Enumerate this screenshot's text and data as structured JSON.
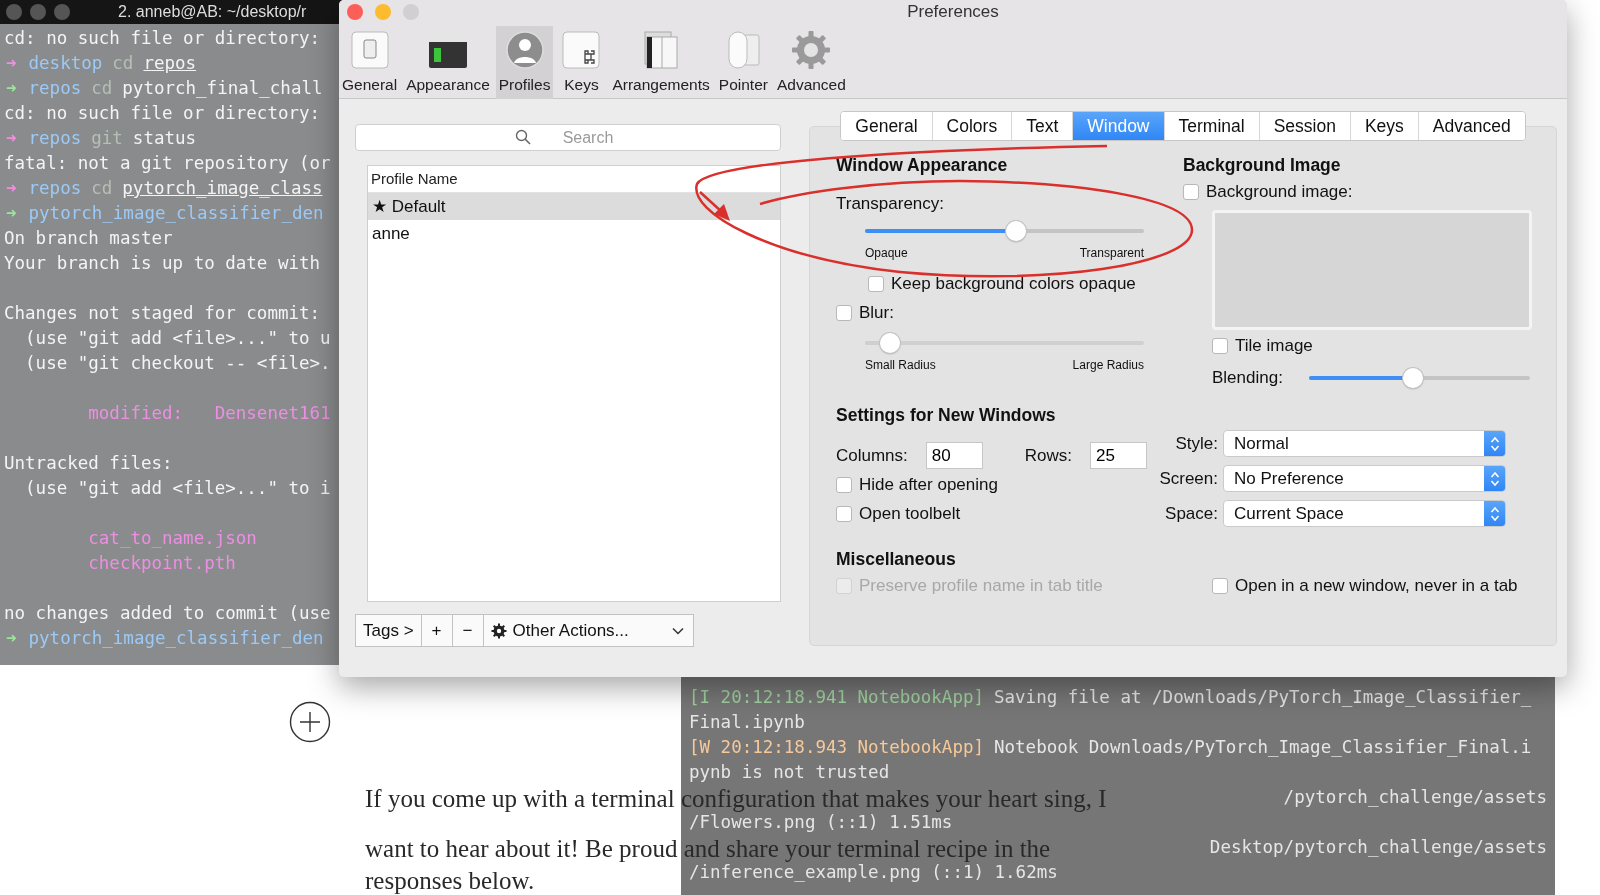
{
  "terminal": {
    "title": "2. anneb@AB: ~/desktop/r",
    "lines": [
      {
        "kind": "text",
        "segments": [
          {
            "kind": "plain",
            "text": "cd: no such file or directory:"
          }
        ]
      },
      {
        "kind": "text",
        "segments": [
          {
            "kind": "arrow",
            "text": "➜",
            "color": "#f08ee0"
          },
          {
            "kind": "dir",
            "text": "desktop"
          },
          {
            "kind": "cmd",
            "text": "cd"
          },
          {
            "kind": "path",
            "text": "repos"
          }
        ]
      },
      {
        "kind": "text",
        "segments": [
          {
            "kind": "arrow",
            "text": "➜",
            "color": "#9be59b"
          },
          {
            "kind": "dir",
            "text": "repos"
          },
          {
            "kind": "cmd",
            "text": "cd"
          },
          {
            "kind": "plain",
            "text": "pytorch_final_chall"
          }
        ]
      },
      {
        "kind": "text",
        "segments": [
          {
            "kind": "plain",
            "text": "cd: no such file or directory:"
          }
        ]
      },
      {
        "kind": "text",
        "segments": [
          {
            "kind": "arrow",
            "text": "➜",
            "color": "#f08ee0"
          },
          {
            "kind": "dir",
            "text": "repos"
          },
          {
            "kind": "cmd",
            "text": "git"
          },
          {
            "kind": "plain",
            "text": "status"
          }
        ]
      },
      {
        "kind": "text",
        "segments": [
          {
            "kind": "plain",
            "text": "fatal: not a git repository (or"
          }
        ]
      },
      {
        "kind": "text",
        "segments": [
          {
            "kind": "arrow",
            "text": "➜",
            "color": "#f08ee0"
          },
          {
            "kind": "dir",
            "text": "repos"
          },
          {
            "kind": "cmd",
            "text": "cd"
          },
          {
            "kind": "path",
            "text": "pytorch_image_class"
          }
        ]
      },
      {
        "kind": "text",
        "segments": [
          {
            "kind": "arrow",
            "text": "➜",
            "color": "#9be59b"
          },
          {
            "kind": "dir",
            "text": "pytorch_image_classifier_den"
          }
        ]
      },
      {
        "kind": "text",
        "segments": [
          {
            "kind": "plain",
            "text": "On branch master"
          }
        ]
      },
      {
        "kind": "text",
        "segments": [
          {
            "kind": "plain",
            "text": "Your branch is up to date with"
          }
        ]
      },
      {
        "kind": "blank"
      },
      {
        "kind": "text",
        "segments": [
          {
            "kind": "plain",
            "text": "Changes not staged for commit:"
          }
        ]
      },
      {
        "kind": "text",
        "segments": [
          {
            "kind": "plain",
            "text": "  (use \"git add <file>...\" to u"
          }
        ]
      },
      {
        "kind": "text",
        "segments": [
          {
            "kind": "plain",
            "text": "  (use \"git checkout -- <file>."
          }
        ]
      },
      {
        "kind": "blank"
      },
      {
        "kind": "text",
        "segments": [
          {
            "kind": "file",
            "text": "        modified:   Densenet161"
          }
        ]
      },
      {
        "kind": "blank"
      },
      {
        "kind": "text",
        "segments": [
          {
            "kind": "plain",
            "text": "Untracked files:"
          }
        ]
      },
      {
        "kind": "text",
        "segments": [
          {
            "kind": "plain",
            "text": "  (use \"git add <file>...\" to i"
          }
        ]
      },
      {
        "kind": "blank"
      },
      {
        "kind": "text",
        "segments": [
          {
            "kind": "file",
            "text": "        cat_to_name.json"
          }
        ]
      },
      {
        "kind": "text",
        "segments": [
          {
            "kind": "file",
            "text": "        checkpoint.pth"
          }
        ]
      },
      {
        "kind": "blank"
      },
      {
        "kind": "text",
        "segments": [
          {
            "kind": "plain",
            "text": "no changes added to commit (use"
          }
        ]
      },
      {
        "kind": "text",
        "segments": [
          {
            "kind": "arrow",
            "text": "➜",
            "color": "#9be59b"
          },
          {
            "kind": "dir",
            "text": "pytorch_image_classifier_den"
          }
        ]
      }
    ]
  },
  "preferences": {
    "title": "Preferences",
    "toolbar": [
      {
        "label": "General",
        "selected": false
      },
      {
        "label": "Appearance",
        "selected": false
      },
      {
        "label": "Profiles",
        "selected": true
      },
      {
        "label": "Keys",
        "selected": false
      },
      {
        "label": "Arrangements",
        "selected": false
      },
      {
        "label": "Pointer",
        "selected": false
      },
      {
        "label": "Advanced",
        "selected": false
      }
    ],
    "profiles": {
      "search_placeholder": "Search",
      "column": "Profile Name",
      "items": [
        {
          "name": "★ Default",
          "selected": true
        },
        {
          "name": "anne",
          "selected": false
        }
      ],
      "tags_button": "Tags >",
      "add_button": "+",
      "remove_button": "−",
      "actions_menu": "Other Actions..."
    },
    "tabs": [
      {
        "label": "General",
        "selected": false
      },
      {
        "label": "Colors",
        "selected": false
      },
      {
        "label": "Text",
        "selected": false
      },
      {
        "label": "Window",
        "selected": true
      },
      {
        "label": "Terminal",
        "selected": false
      },
      {
        "label": "Session",
        "selected": false
      },
      {
        "label": "Keys",
        "selected": false
      },
      {
        "label": "Advanced",
        "selected": false
      }
    ],
    "window_appearance": {
      "heading": "Window Appearance",
      "transparency": {
        "label": "Transparency:",
        "level": 0.54,
        "min_label": "Opaque",
        "max_label": "Transparent"
      },
      "keep_opaque": {
        "label": "Keep background colors opaque",
        "checked": false
      },
      "blur": {
        "label": "Blur:",
        "checked": false,
        "level": 0.09,
        "min_label": "Small Radius",
        "max_label": "Large Radius"
      }
    },
    "background_image": {
      "heading": "Background Image",
      "enabled": {
        "label": "Background image:",
        "checked": false
      },
      "tile": {
        "label": "Tile image",
        "checked": false
      },
      "blending": {
        "label": "Blending:",
        "level": 0.47
      }
    },
    "new_windows": {
      "heading": "Settings for New Windows",
      "columns": {
        "label": "Columns:",
        "value": "80"
      },
      "rows": {
        "label": "Rows:",
        "value": "25"
      },
      "hide_after_opening": {
        "label": "Hide after opening",
        "checked": false
      },
      "open_toolbelt": {
        "label": "Open toolbelt",
        "checked": false
      },
      "popups": [
        {
          "label": "Style:",
          "value": "Normal"
        },
        {
          "label": "Screen:",
          "value": "No Preference"
        },
        {
          "label": "Space:",
          "value": "Current Space"
        }
      ]
    },
    "misc": {
      "heading": "Miscellaneous",
      "preserve_name": {
        "label": "Preserve profile name in tab title",
        "checked": false,
        "disabled": true
      },
      "new_window": {
        "label": "Open in a new window, never in a tab",
        "checked": false,
        "disabled": false
      }
    }
  },
  "jupyter": {
    "lines": [
      {
        "kind": "info",
        "prefix": "[I 20:12:18.941 NotebookApp]",
        "text": "Saving file at /Downloads/PyTorch_Image_Classifier_"
      },
      {
        "kind": "cont",
        "text": "Final.ipynb"
      },
      {
        "kind": "warn",
        "prefix": "[W 20:12:18.943 NotebookApp]",
        "text": "Notebook Downloads/PyTorch_Image_Classifier_Final.i"
      },
      {
        "kind": "cont",
        "text": "pynb is not trusted"
      },
      {
        "kind": "tail",
        "text": "/pytorch_challenge/assets"
      },
      {
        "kind": "cont",
        "text": "/Flowers.png (::1) 1.51ms"
      },
      {
        "kind": "tail",
        "text": "Desktop/pytorch_challenge/assets"
      },
      {
        "kind": "cont",
        "text": "/inference_example.png (::1) 1.62ms"
      }
    ]
  },
  "article": {
    "paragraph_lines": [
      "If you come up with a terminal configuration that makes your heart sing, I",
      "want to hear about it! Be proud and share your terminal recipe in the",
      "responses below."
    ]
  }
}
